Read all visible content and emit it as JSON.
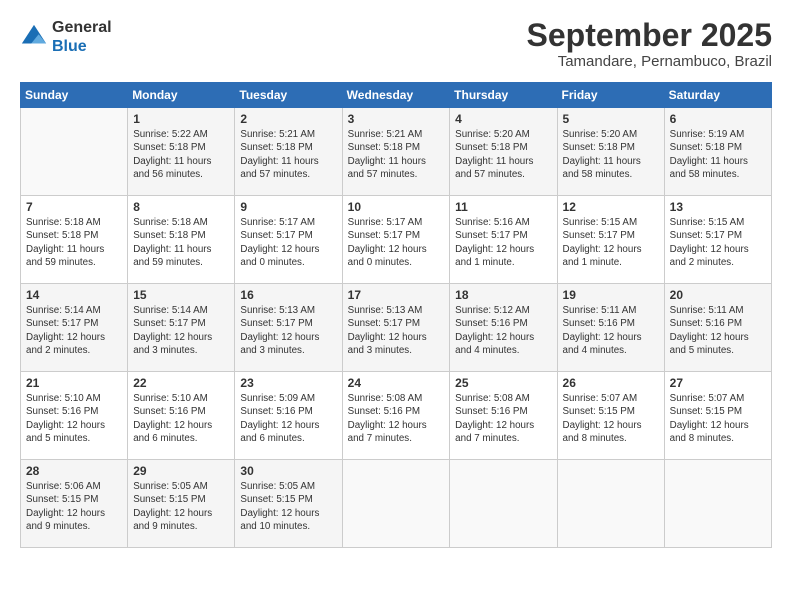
{
  "logo": {
    "general": "General",
    "blue": "Blue"
  },
  "title": "September 2025",
  "location": "Tamandare, Pernambuco, Brazil",
  "days_of_week": [
    "Sunday",
    "Monday",
    "Tuesday",
    "Wednesday",
    "Thursday",
    "Friday",
    "Saturday"
  ],
  "weeks": [
    [
      {
        "day": "",
        "info": ""
      },
      {
        "day": "1",
        "info": "Sunrise: 5:22 AM\nSunset: 5:18 PM\nDaylight: 11 hours\nand 56 minutes."
      },
      {
        "day": "2",
        "info": "Sunrise: 5:21 AM\nSunset: 5:18 PM\nDaylight: 11 hours\nand 57 minutes."
      },
      {
        "day": "3",
        "info": "Sunrise: 5:21 AM\nSunset: 5:18 PM\nDaylight: 11 hours\nand 57 minutes."
      },
      {
        "day": "4",
        "info": "Sunrise: 5:20 AM\nSunset: 5:18 PM\nDaylight: 11 hours\nand 57 minutes."
      },
      {
        "day": "5",
        "info": "Sunrise: 5:20 AM\nSunset: 5:18 PM\nDaylight: 11 hours\nand 58 minutes."
      },
      {
        "day": "6",
        "info": "Sunrise: 5:19 AM\nSunset: 5:18 PM\nDaylight: 11 hours\nand 58 minutes."
      }
    ],
    [
      {
        "day": "7",
        "info": "Sunrise: 5:18 AM\nSunset: 5:18 PM\nDaylight: 11 hours\nand 59 minutes."
      },
      {
        "day": "8",
        "info": "Sunrise: 5:18 AM\nSunset: 5:18 PM\nDaylight: 11 hours\nand 59 minutes."
      },
      {
        "day": "9",
        "info": "Sunrise: 5:17 AM\nSunset: 5:17 PM\nDaylight: 12 hours\nand 0 minutes."
      },
      {
        "day": "10",
        "info": "Sunrise: 5:17 AM\nSunset: 5:17 PM\nDaylight: 12 hours\nand 0 minutes."
      },
      {
        "day": "11",
        "info": "Sunrise: 5:16 AM\nSunset: 5:17 PM\nDaylight: 12 hours\nand 1 minute."
      },
      {
        "day": "12",
        "info": "Sunrise: 5:15 AM\nSunset: 5:17 PM\nDaylight: 12 hours\nand 1 minute."
      },
      {
        "day": "13",
        "info": "Sunrise: 5:15 AM\nSunset: 5:17 PM\nDaylight: 12 hours\nand 2 minutes."
      }
    ],
    [
      {
        "day": "14",
        "info": "Sunrise: 5:14 AM\nSunset: 5:17 PM\nDaylight: 12 hours\nand 2 minutes."
      },
      {
        "day": "15",
        "info": "Sunrise: 5:14 AM\nSunset: 5:17 PM\nDaylight: 12 hours\nand 3 minutes."
      },
      {
        "day": "16",
        "info": "Sunrise: 5:13 AM\nSunset: 5:17 PM\nDaylight: 12 hours\nand 3 minutes."
      },
      {
        "day": "17",
        "info": "Sunrise: 5:13 AM\nSunset: 5:17 PM\nDaylight: 12 hours\nand 3 minutes."
      },
      {
        "day": "18",
        "info": "Sunrise: 5:12 AM\nSunset: 5:16 PM\nDaylight: 12 hours\nand 4 minutes."
      },
      {
        "day": "19",
        "info": "Sunrise: 5:11 AM\nSunset: 5:16 PM\nDaylight: 12 hours\nand 4 minutes."
      },
      {
        "day": "20",
        "info": "Sunrise: 5:11 AM\nSunset: 5:16 PM\nDaylight: 12 hours\nand 5 minutes."
      }
    ],
    [
      {
        "day": "21",
        "info": "Sunrise: 5:10 AM\nSunset: 5:16 PM\nDaylight: 12 hours\nand 5 minutes."
      },
      {
        "day": "22",
        "info": "Sunrise: 5:10 AM\nSunset: 5:16 PM\nDaylight: 12 hours\nand 6 minutes."
      },
      {
        "day": "23",
        "info": "Sunrise: 5:09 AM\nSunset: 5:16 PM\nDaylight: 12 hours\nand 6 minutes."
      },
      {
        "day": "24",
        "info": "Sunrise: 5:08 AM\nSunset: 5:16 PM\nDaylight: 12 hours\nand 7 minutes."
      },
      {
        "day": "25",
        "info": "Sunrise: 5:08 AM\nSunset: 5:16 PM\nDaylight: 12 hours\nand 7 minutes."
      },
      {
        "day": "26",
        "info": "Sunrise: 5:07 AM\nSunset: 5:15 PM\nDaylight: 12 hours\nand 8 minutes."
      },
      {
        "day": "27",
        "info": "Sunrise: 5:07 AM\nSunset: 5:15 PM\nDaylight: 12 hours\nand 8 minutes."
      }
    ],
    [
      {
        "day": "28",
        "info": "Sunrise: 5:06 AM\nSunset: 5:15 PM\nDaylight: 12 hours\nand 9 minutes."
      },
      {
        "day": "29",
        "info": "Sunrise: 5:05 AM\nSunset: 5:15 PM\nDaylight: 12 hours\nand 9 minutes."
      },
      {
        "day": "30",
        "info": "Sunrise: 5:05 AM\nSunset: 5:15 PM\nDaylight: 12 hours\nand 10 minutes."
      },
      {
        "day": "",
        "info": ""
      },
      {
        "day": "",
        "info": ""
      },
      {
        "day": "",
        "info": ""
      },
      {
        "day": "",
        "info": ""
      }
    ]
  ]
}
